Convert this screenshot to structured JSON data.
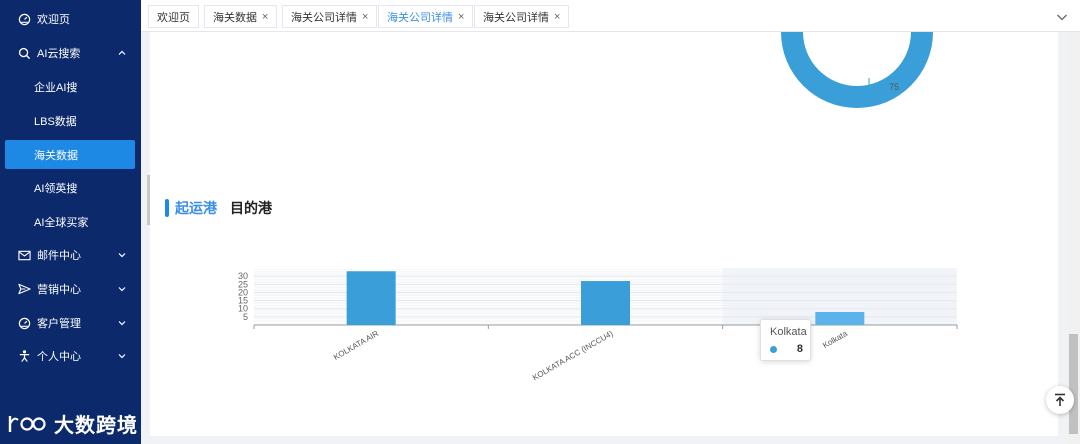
{
  "sidebar": {
    "items": [
      {
        "label": "欢迎页",
        "icon": "dashboard-icon",
        "chevron": ""
      },
      {
        "label": "AI云搜索",
        "icon": "search-icon",
        "chevron": "up"
      },
      {
        "label": "邮件中心",
        "icon": "mail-icon",
        "chevron": "down"
      },
      {
        "label": "营销中心",
        "icon": "send-icon",
        "chevron": "down"
      },
      {
        "label": "客户管理",
        "icon": "dashboard-icon",
        "chevron": "down"
      },
      {
        "label": "个人中心",
        "icon": "person-icon",
        "chevron": "down"
      }
    ],
    "subitems": [
      {
        "label": "企业AI搜",
        "active": false
      },
      {
        "label": "LBS数据",
        "active": false
      },
      {
        "label": "海关数据",
        "active": true
      },
      {
        "label": "AI领英搜",
        "active": false
      },
      {
        "label": "AI全球买家",
        "active": false
      }
    ],
    "logo_text": "大数跨境"
  },
  "tabs": [
    {
      "label": "欢迎页",
      "closable": false,
      "active": false
    },
    {
      "label": "海关数据",
      "closable": true,
      "active": false
    },
    {
      "label": "海关公司详情",
      "closable": true,
      "active": false
    },
    {
      "label": "海关公司详情",
      "closable": true,
      "active": true
    },
    {
      "label": "海关公司详情",
      "closable": true,
      "active": false
    }
  ],
  "tab_close_symbol": "×",
  "donut": {
    "visible_label": "75",
    "color": "#3a9fd8"
  },
  "section": {
    "tab_active": "起运港",
    "tab_inactive": "目的港"
  },
  "chart_data": {
    "type": "bar",
    "categories": [
      "KOLKATA AIR",
      "KOLKATA ACC (INCCU4)",
      "Kolkata"
    ],
    "values": [
      33,
      27,
      8
    ],
    "ylim": [
      0,
      35
    ],
    "yticks": [
      5,
      10,
      15,
      20,
      25,
      30
    ],
    "grid": true,
    "bar_color": "#3a9fd8",
    "highlight_index": 2,
    "highlight_color": "#5ab3ea"
  },
  "tooltip": {
    "name": "Kolkata",
    "value": "8"
  },
  "colors": {
    "sidebar_bg": "#0c2a6b",
    "accent": "#1e88e5"
  }
}
